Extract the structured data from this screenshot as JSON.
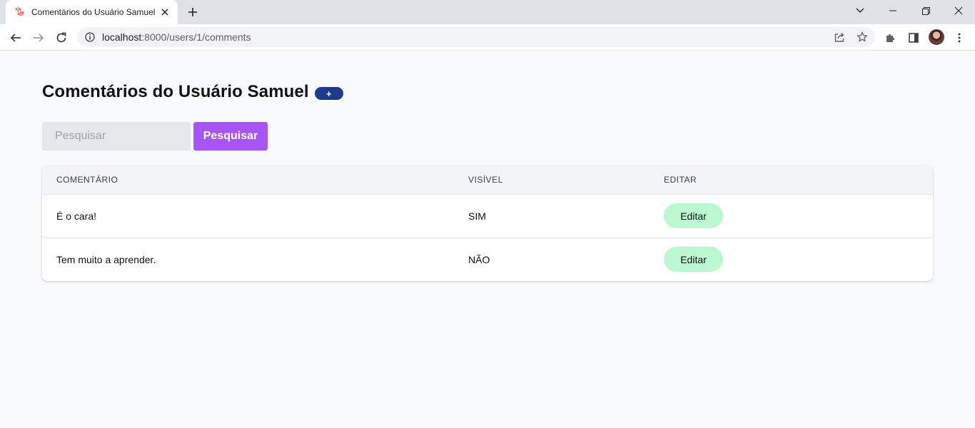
{
  "browser": {
    "tab_title": "Comentários do Usuário Samuel",
    "url_host": "localhost",
    "url_path": ":8000/users/1/comments"
  },
  "colors": {
    "favicon": "#f05340",
    "add_button": "#1e3a8a",
    "search_button": "#a855f7",
    "edit_button": "#bbf7d0"
  },
  "page": {
    "title": "Comentários do Usuário Samuel",
    "add_label": "+"
  },
  "search": {
    "placeholder": "Pesquisar",
    "value": "",
    "button_label": "Pesquisar"
  },
  "table": {
    "headers": [
      "COMENTÁRIO",
      "VISÍVEL",
      "EDITAR"
    ],
    "rows": [
      {
        "comment": "É o cara!",
        "visible": "SIM",
        "edit_label": "Editar"
      },
      {
        "comment": "Tem muito a aprender.",
        "visible": "NÃO",
        "edit_label": "Editar"
      }
    ]
  }
}
